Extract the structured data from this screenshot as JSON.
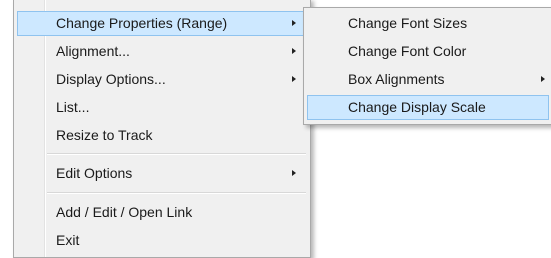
{
  "context_menu": {
    "items": [
      {
        "label": "Change Properties (Range)"
      },
      {
        "label": "Alignment..."
      },
      {
        "label": "Display Options..."
      },
      {
        "label": "List..."
      },
      {
        "label": "Resize to Track"
      },
      {
        "label": "Edit Options"
      },
      {
        "label": "Add / Edit / Open Link"
      },
      {
        "label": "Exit"
      }
    ]
  },
  "submenu": {
    "items": [
      {
        "label": "Change Font Sizes"
      },
      {
        "label": "Change Font Color"
      },
      {
        "label": "Box Alignments"
      },
      {
        "label": "Change Display Scale"
      }
    ]
  },
  "colors": {
    "menu_bg": "#f0f0f0",
    "highlight": "#cde8ff",
    "highlight_border": "#8fc3ef"
  }
}
